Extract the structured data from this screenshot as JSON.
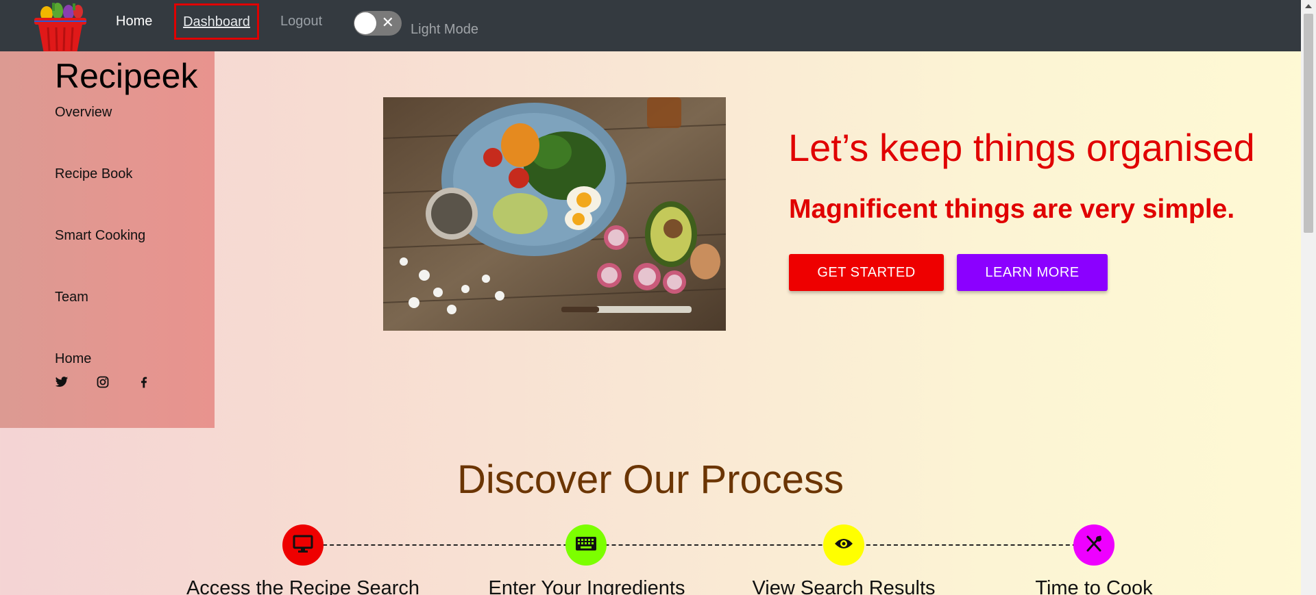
{
  "nav": {
    "home": "Home",
    "dashboard": "Dashboard",
    "logout": "Logout",
    "mode_toggle_label": "Light Mode",
    "mode_toggle_state": "off"
  },
  "sidebar": {
    "brand": "Recipeek",
    "items": [
      {
        "label": "Overview"
      },
      {
        "label": "Recipe Book"
      },
      {
        "label": "Smart Cooking"
      },
      {
        "label": "Team"
      },
      {
        "label": "Home"
      }
    ],
    "social": [
      "twitter-icon",
      "instagram-icon",
      "facebook-icon"
    ]
  },
  "hero": {
    "title": "Let’s keep things organised",
    "subtitle": "Magnificent things are very simple.",
    "primary_button": "GET STARTED",
    "secondary_button": "LEARN MORE",
    "colors": {
      "title": "#e00000",
      "primary": "#ee0000",
      "secondary": "#8b00ff"
    }
  },
  "process": {
    "title": "Discover Our Process",
    "steps": [
      {
        "label": "Access the Recipe Search",
        "icon": "desktop-icon",
        "color": "#ee0000"
      },
      {
        "label": "Enter Your Ingredients",
        "icon": "keyboard-icon",
        "color": "#7cff00"
      },
      {
        "label": "View Search Results",
        "icon": "eye-icon",
        "color": "#ffff00"
      },
      {
        "label": "Time to Cook",
        "icon": "utensils-icon",
        "color": "#ee00ff"
      }
    ]
  }
}
